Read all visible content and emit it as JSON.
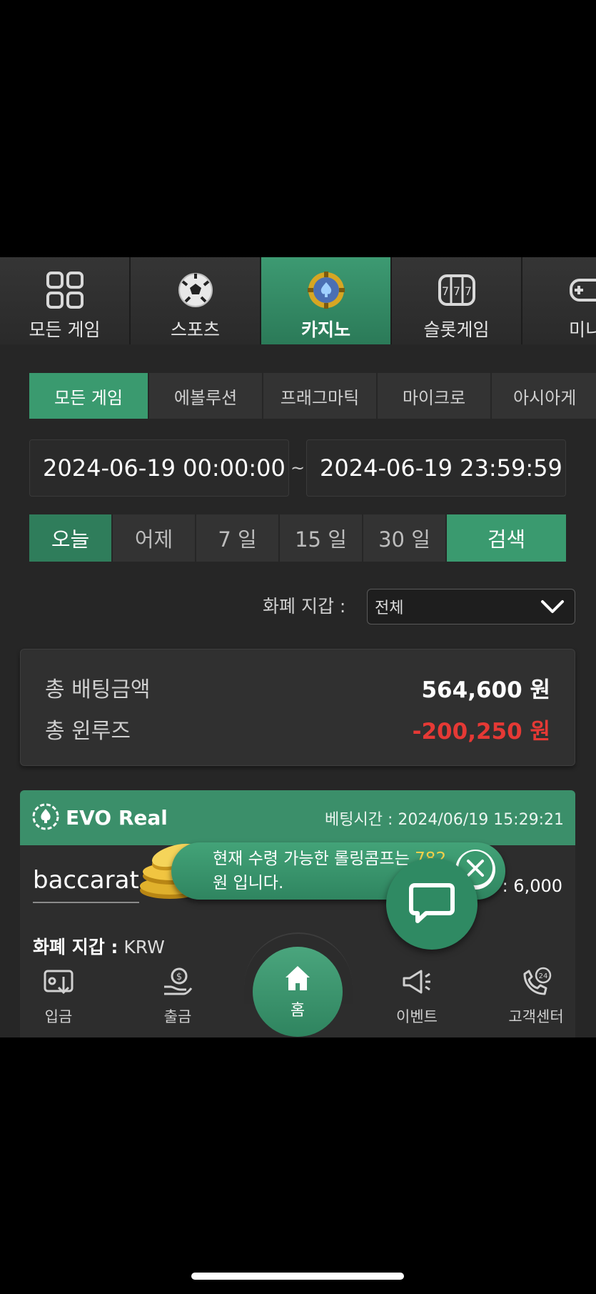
{
  "category_tabs": [
    {
      "label": "모든 게임",
      "icon": "grid-icon"
    },
    {
      "label": "스포츠",
      "icon": "soccer-ball-icon"
    },
    {
      "label": "카지노",
      "icon": "casino-chip-icon",
      "active": true
    },
    {
      "label": "슬롯게임",
      "icon": "slot-machine-icon"
    },
    {
      "label": "미니",
      "icon": "gamepad-icon"
    }
  ],
  "provider_tabs": [
    {
      "label": "모든 게임",
      "active": true
    },
    {
      "label": "에볼루션"
    },
    {
      "label": "프래그마틱"
    },
    {
      "label": "마이크로"
    },
    {
      "label": "아시아게"
    }
  ],
  "date_filter": {
    "start": "2024-06-19 00:00:00",
    "end": "2024-06-19 23:59:59",
    "separator": "~"
  },
  "quick_ranges": [
    {
      "label": "오늘",
      "active": true
    },
    {
      "label": "어제"
    },
    {
      "label": "7 일"
    },
    {
      "label": "15 일"
    },
    {
      "label": "30 일"
    }
  ],
  "search_label": "검색",
  "wallet_filter": {
    "label": "화폐 지갑 :",
    "selected": "전체"
  },
  "summary": {
    "total_bet_label": "총 배팅금액",
    "total_bet_value": "564,600 원",
    "total_winloss_label": "총 윈루즈",
    "total_winloss_value": "-200,250 원"
  },
  "bet_card": {
    "provider": "EVO Real",
    "time_label": "베팅시간 : 2024/06/19 15:29:21",
    "game": "baccarat",
    "amount": ": 6,000",
    "wallet_label": "화폐 지갑 :",
    "wallet_value": "KRW"
  },
  "toast": {
    "line1_prefix": "현재 수령 가능한 롤링콤프는",
    "line1_value": "782",
    "line2": "원 입니다."
  },
  "bottom_nav": {
    "deposit": "입금",
    "withdraw": "출금",
    "home": "홈",
    "event": "이벤트",
    "support": "고객센터"
  },
  "colors": {
    "accent_green": "#3a9a6f",
    "negative_red": "#e53935",
    "highlight_yellow": "#f6d24a"
  }
}
